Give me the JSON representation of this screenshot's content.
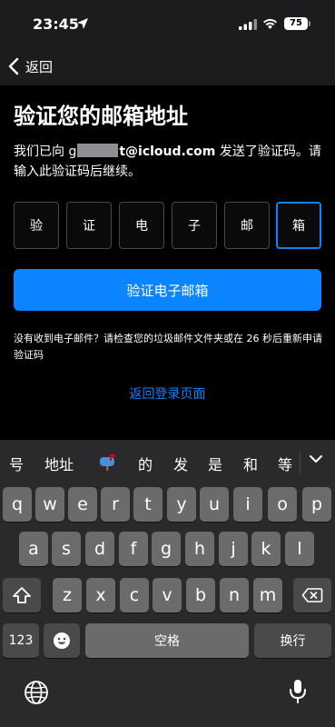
{
  "status_bar": {
    "time": "23:45",
    "battery": "75",
    "icons": [
      "location-arrow-icon",
      "signal-icon",
      "wifi-icon",
      "battery-icon"
    ]
  },
  "nav": {
    "back_label": "返回",
    "back_icon": "chevron-left-icon"
  },
  "page": {
    "title": "验证您的邮箱地址",
    "desc_prefix": "我们已向 g",
    "desc_email_suffix": "t@icloud.com",
    "desc_rest": " 发送了验证码。请输入此验证码后继续。",
    "code_chars": [
      "验",
      "证",
      "电",
      "子",
      "邮",
      "箱"
    ],
    "verify_button": "验证电子邮箱",
    "hint": "没有收到电子邮件？请检查您的垃圾邮件文件夹或在 26 秒后重新申请验证码",
    "return_link": "返回登录页面",
    "accent_color": "#0a84ff"
  },
  "keyboard": {
    "candidates": [
      "号",
      "地址",
      "的",
      "发",
      "是",
      "和",
      "等"
    ],
    "row1": [
      "q",
      "w",
      "e",
      "r",
      "t",
      "y",
      "u",
      "i",
      "o",
      "p"
    ],
    "row2": [
      "a",
      "s",
      "d",
      "f",
      "g",
      "h",
      "j",
      "k",
      "l"
    ],
    "row3": [
      "z",
      "x",
      "c",
      "v",
      "b",
      "n",
      "m"
    ],
    "numbers_key": "123",
    "space_key": "空格",
    "return_key": "换行",
    "icons": [
      "mailbox-emoji-icon",
      "chevron-down-icon",
      "shift-icon",
      "delete-icon",
      "emoji-icon",
      "globe-icon",
      "microphone-icon"
    ]
  }
}
